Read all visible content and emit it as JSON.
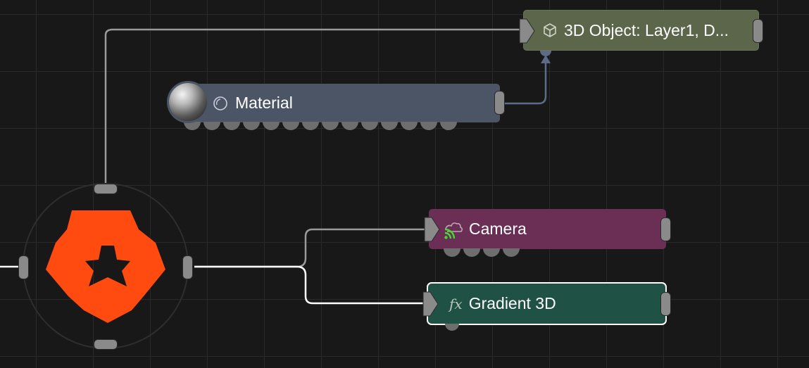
{
  "nodes": {
    "object3d": {
      "label": "3D Object: Layer1, D...",
      "color": "#5b664b",
      "icon": "cube-icon"
    },
    "material": {
      "label": "Material",
      "color": "#4b5566",
      "icon": "material-swatch-icon",
      "preview": "sphere-preview"
    },
    "camera": {
      "label": "Camera",
      "color": "#6b2e55",
      "icon": "camera-icon",
      "status_color": "#3ee02d"
    },
    "gradient": {
      "label": "Gradient 3D",
      "color": "#1f5244",
      "icon": "fx-icon",
      "icon_text": "fx",
      "selected": true
    },
    "hub": {
      "color": "#ff4a10",
      "icon": "star-gear-icon"
    }
  },
  "colors": {
    "background": "#181818",
    "grid": "#2a2a2a",
    "wire": "#9a9a9a",
    "wire_selected": "#ffffff",
    "port": "#8a8a8a",
    "dependency_wire": "#5d6c86"
  }
}
